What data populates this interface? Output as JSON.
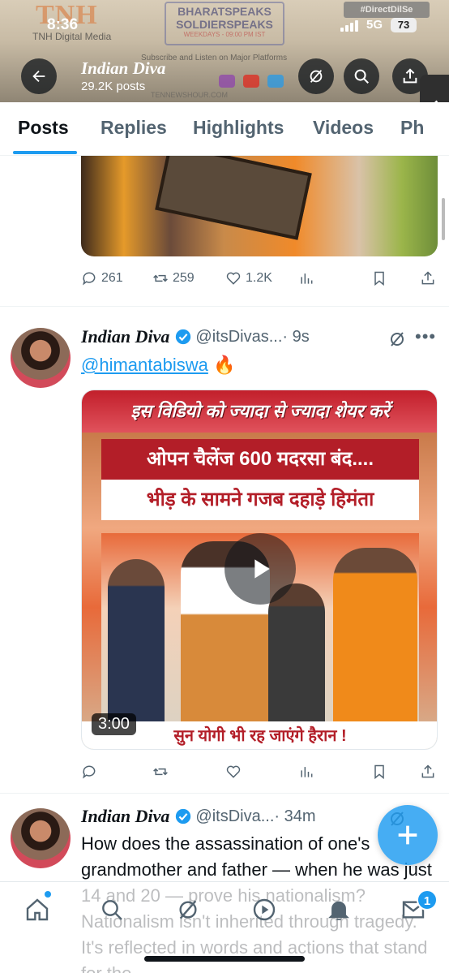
{
  "status_bar": {
    "time": "8:36",
    "network": "5G",
    "battery": "73"
  },
  "banner": {
    "logo": "TNH",
    "logo_sub": "TNH Digital Media",
    "box_line1": "BHARATSPEAKS",
    "box_line2": "SOLDIERSPEAKS",
    "box_line3": "WEEKDAYS - 09:00 PM IST",
    "tag": "#DirectDilSe",
    "subscribe": "Subscribe and Listen on Major Platforms",
    "url": "TENNEWSHOUR.COM"
  },
  "header": {
    "name": "Indian Diva",
    "posts": "29.2K posts"
  },
  "tabs": [
    "Posts",
    "Replies",
    "Highlights",
    "Videos",
    "Ph"
  ],
  "prev_post": {
    "replies": "261",
    "reposts": "259",
    "likes": "1.2K"
  },
  "post1": {
    "name": "Indian Diva",
    "handle": "@itsDivas...",
    "time": "· 9s",
    "mention": "@himantabiswa",
    "emoji": "🔥",
    "video": {
      "top_text": "इस विडियो को ज्यादा से ज्यादा शेयर करें",
      "line1": "ओपन चैलेंज 600 मदरसा बंद....",
      "line2": "भीड़ के सामने गजब दहाड़े हिमंता",
      "caption": "सुन योगी भी रह जाएंगे हैरान !",
      "duration": "3:00"
    }
  },
  "post2": {
    "name": "Indian Diva",
    "handle": "@itsDiva...",
    "time": "· 34m",
    "text": "How does the assassination of one's grandmother and father — when he was just 14 and 20 — prove his nationalism? Nationalism isn't inherited through tragedy. It's reflected in words and actions that stand for the"
  },
  "nav": {
    "notifications_badge": "1"
  },
  "colors": {
    "accent": "#1d9bf0",
    "text": "#0f1419",
    "muted": "#536471"
  }
}
